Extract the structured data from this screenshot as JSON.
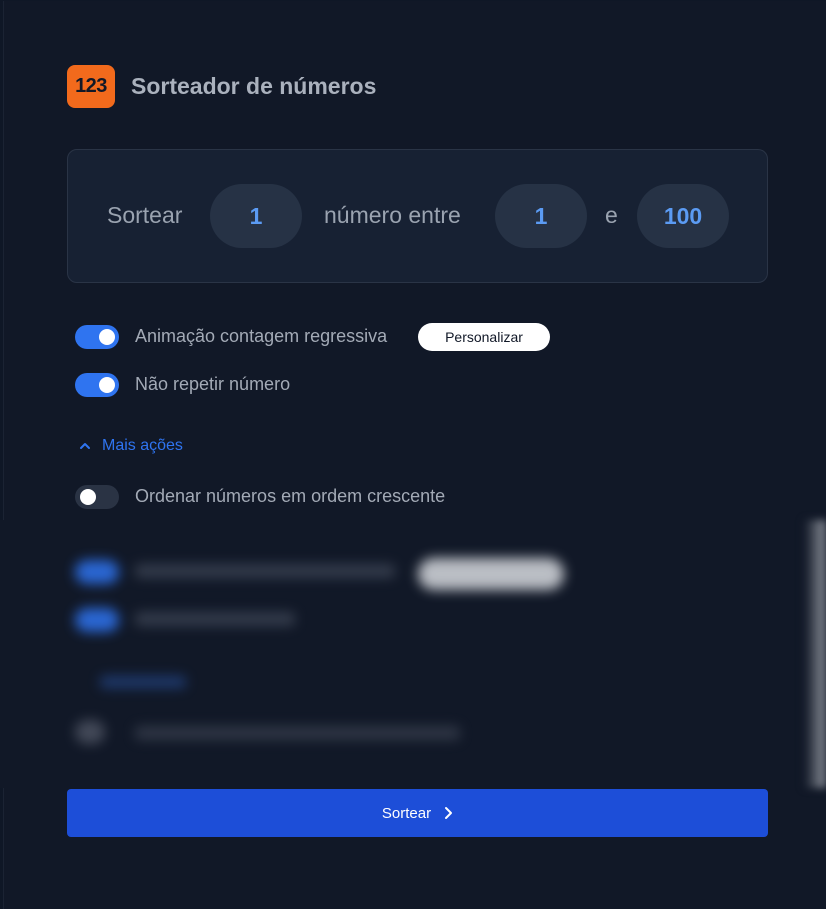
{
  "header": {
    "icon_text": "123",
    "title": "Sorteador de números"
  },
  "draw": {
    "prefix": "Sortear",
    "quantity": "1",
    "middle": "número entre",
    "min": "1",
    "conjunction": "e",
    "max": "100"
  },
  "options": {
    "countdown_label": "Animação contagem regressiva",
    "countdown_on": true,
    "customize_label": "Personalizar",
    "no_repeat_label": "Não repetir número",
    "no_repeat_on": true
  },
  "more_actions": {
    "label": "Mais ações",
    "sort_label": "Ordenar números em ordem crescente",
    "sort_on": false
  },
  "submit": {
    "label": "Sortear"
  },
  "colors": {
    "accent": "#2f74f0",
    "button": "#1d4ed8",
    "icon_bg": "#f26a1c",
    "number": "#5b9bf3"
  }
}
